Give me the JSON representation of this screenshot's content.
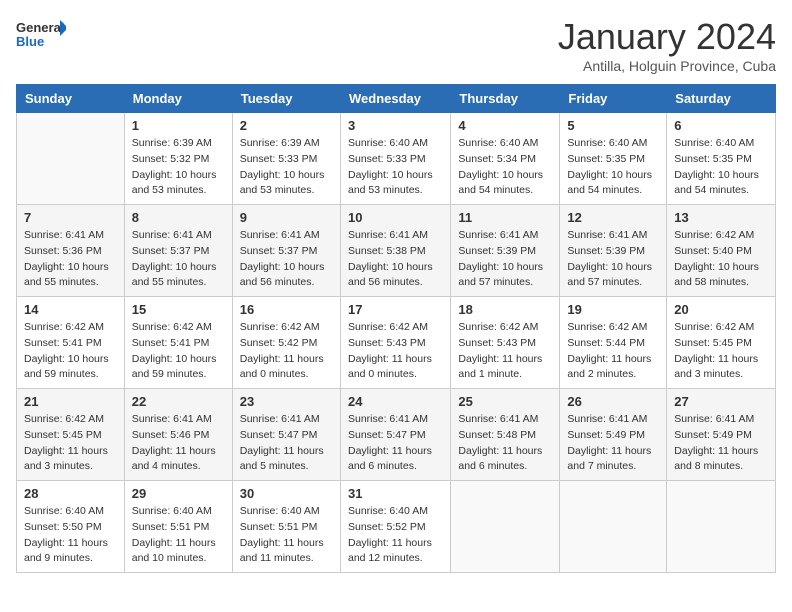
{
  "header": {
    "logo_general": "General",
    "logo_blue": "Blue",
    "month_title": "January 2024",
    "subtitle": "Antilla, Holguin Province, Cuba"
  },
  "weekdays": [
    "Sunday",
    "Monday",
    "Tuesday",
    "Wednesday",
    "Thursday",
    "Friday",
    "Saturday"
  ],
  "weeks": [
    [
      {
        "day": "",
        "empty": true
      },
      {
        "day": "1",
        "sunrise": "Sunrise: 6:39 AM",
        "sunset": "Sunset: 5:32 PM",
        "daylight": "Daylight: 10 hours and 53 minutes."
      },
      {
        "day": "2",
        "sunrise": "Sunrise: 6:39 AM",
        "sunset": "Sunset: 5:33 PM",
        "daylight": "Daylight: 10 hours and 53 minutes."
      },
      {
        "day": "3",
        "sunrise": "Sunrise: 6:40 AM",
        "sunset": "Sunset: 5:33 PM",
        "daylight": "Daylight: 10 hours and 53 minutes."
      },
      {
        "day": "4",
        "sunrise": "Sunrise: 6:40 AM",
        "sunset": "Sunset: 5:34 PM",
        "daylight": "Daylight: 10 hours and 54 minutes."
      },
      {
        "day": "5",
        "sunrise": "Sunrise: 6:40 AM",
        "sunset": "Sunset: 5:35 PM",
        "daylight": "Daylight: 10 hours and 54 minutes."
      },
      {
        "day": "6",
        "sunrise": "Sunrise: 6:40 AM",
        "sunset": "Sunset: 5:35 PM",
        "daylight": "Daylight: 10 hours and 54 minutes."
      }
    ],
    [
      {
        "day": "7",
        "sunrise": "Sunrise: 6:41 AM",
        "sunset": "Sunset: 5:36 PM",
        "daylight": "Daylight: 10 hours and 55 minutes."
      },
      {
        "day": "8",
        "sunrise": "Sunrise: 6:41 AM",
        "sunset": "Sunset: 5:37 PM",
        "daylight": "Daylight: 10 hours and 55 minutes."
      },
      {
        "day": "9",
        "sunrise": "Sunrise: 6:41 AM",
        "sunset": "Sunset: 5:37 PM",
        "daylight": "Daylight: 10 hours and 56 minutes."
      },
      {
        "day": "10",
        "sunrise": "Sunrise: 6:41 AM",
        "sunset": "Sunset: 5:38 PM",
        "daylight": "Daylight: 10 hours and 56 minutes."
      },
      {
        "day": "11",
        "sunrise": "Sunrise: 6:41 AM",
        "sunset": "Sunset: 5:39 PM",
        "daylight": "Daylight: 10 hours and 57 minutes."
      },
      {
        "day": "12",
        "sunrise": "Sunrise: 6:41 AM",
        "sunset": "Sunset: 5:39 PM",
        "daylight": "Daylight: 10 hours and 57 minutes."
      },
      {
        "day": "13",
        "sunrise": "Sunrise: 6:42 AM",
        "sunset": "Sunset: 5:40 PM",
        "daylight": "Daylight: 10 hours and 58 minutes."
      }
    ],
    [
      {
        "day": "14",
        "sunrise": "Sunrise: 6:42 AM",
        "sunset": "Sunset: 5:41 PM",
        "daylight": "Daylight: 10 hours and 59 minutes."
      },
      {
        "day": "15",
        "sunrise": "Sunrise: 6:42 AM",
        "sunset": "Sunset: 5:41 PM",
        "daylight": "Daylight: 10 hours and 59 minutes."
      },
      {
        "day": "16",
        "sunrise": "Sunrise: 6:42 AM",
        "sunset": "Sunset: 5:42 PM",
        "daylight": "Daylight: 11 hours and 0 minutes."
      },
      {
        "day": "17",
        "sunrise": "Sunrise: 6:42 AM",
        "sunset": "Sunset: 5:43 PM",
        "daylight": "Daylight: 11 hours and 0 minutes."
      },
      {
        "day": "18",
        "sunrise": "Sunrise: 6:42 AM",
        "sunset": "Sunset: 5:43 PM",
        "daylight": "Daylight: 11 hours and 1 minute."
      },
      {
        "day": "19",
        "sunrise": "Sunrise: 6:42 AM",
        "sunset": "Sunset: 5:44 PM",
        "daylight": "Daylight: 11 hours and 2 minutes."
      },
      {
        "day": "20",
        "sunrise": "Sunrise: 6:42 AM",
        "sunset": "Sunset: 5:45 PM",
        "daylight": "Daylight: 11 hours and 3 minutes."
      }
    ],
    [
      {
        "day": "21",
        "sunrise": "Sunrise: 6:42 AM",
        "sunset": "Sunset: 5:45 PM",
        "daylight": "Daylight: 11 hours and 3 minutes."
      },
      {
        "day": "22",
        "sunrise": "Sunrise: 6:41 AM",
        "sunset": "Sunset: 5:46 PM",
        "daylight": "Daylight: 11 hours and 4 minutes."
      },
      {
        "day": "23",
        "sunrise": "Sunrise: 6:41 AM",
        "sunset": "Sunset: 5:47 PM",
        "daylight": "Daylight: 11 hours and 5 minutes."
      },
      {
        "day": "24",
        "sunrise": "Sunrise: 6:41 AM",
        "sunset": "Sunset: 5:47 PM",
        "daylight": "Daylight: 11 hours and 6 minutes."
      },
      {
        "day": "25",
        "sunrise": "Sunrise: 6:41 AM",
        "sunset": "Sunset: 5:48 PM",
        "daylight": "Daylight: 11 hours and 6 minutes."
      },
      {
        "day": "26",
        "sunrise": "Sunrise: 6:41 AM",
        "sunset": "Sunset: 5:49 PM",
        "daylight": "Daylight: 11 hours and 7 minutes."
      },
      {
        "day": "27",
        "sunrise": "Sunrise: 6:41 AM",
        "sunset": "Sunset: 5:49 PM",
        "daylight": "Daylight: 11 hours and 8 minutes."
      }
    ],
    [
      {
        "day": "28",
        "sunrise": "Sunrise: 6:40 AM",
        "sunset": "Sunset: 5:50 PM",
        "daylight": "Daylight: 11 hours and 9 minutes."
      },
      {
        "day": "29",
        "sunrise": "Sunrise: 6:40 AM",
        "sunset": "Sunset: 5:51 PM",
        "daylight": "Daylight: 11 hours and 10 minutes."
      },
      {
        "day": "30",
        "sunrise": "Sunrise: 6:40 AM",
        "sunset": "Sunset: 5:51 PM",
        "daylight": "Daylight: 11 hours and 11 minutes."
      },
      {
        "day": "31",
        "sunrise": "Sunrise: 6:40 AM",
        "sunset": "Sunset: 5:52 PM",
        "daylight": "Daylight: 11 hours and 12 minutes."
      },
      {
        "day": "",
        "empty": true
      },
      {
        "day": "",
        "empty": true
      },
      {
        "day": "",
        "empty": true
      }
    ]
  ]
}
